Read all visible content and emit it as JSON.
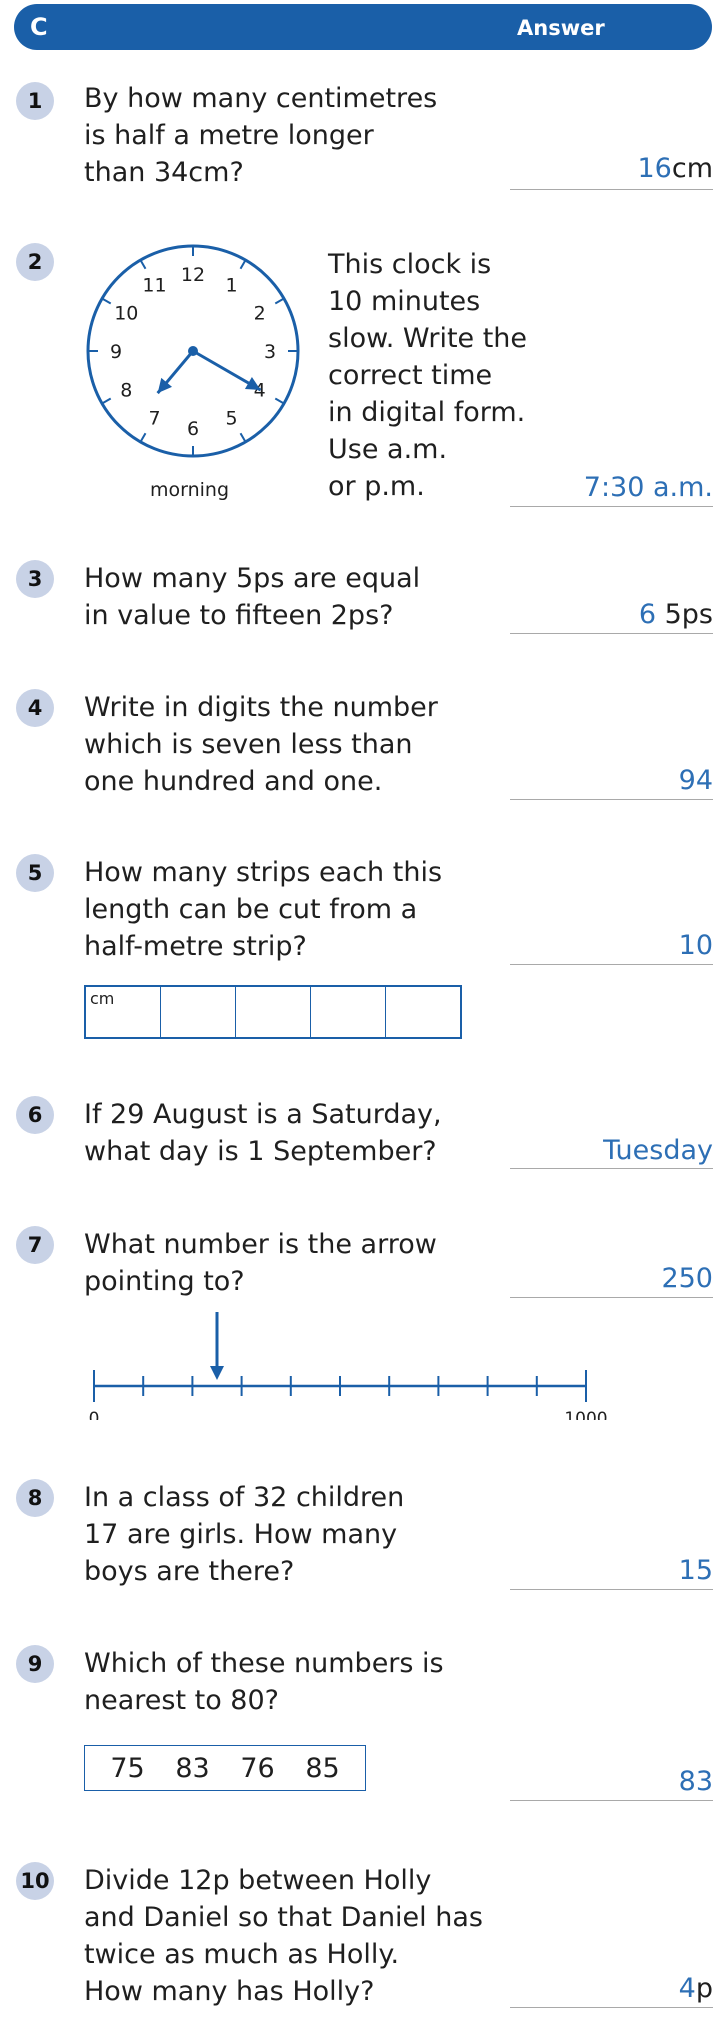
{
  "header": {
    "section": "C",
    "answer_label": "Answer"
  },
  "questions": [
    {
      "num": "1",
      "text": "By how many centimetres\nis half a metre longer\nthan 34cm?",
      "answer": "16",
      "unit": "cm"
    },
    {
      "num": "2",
      "text": "This clock is\n10 minutes\nslow. Write the\ncorrect time\nin digital form.\nUse a.m.\nor p.m.",
      "answer": "7:30 a.m.",
      "unit": "",
      "caption": "morning",
      "clock_numbers": [
        "12",
        "1",
        "2",
        "3",
        "4",
        "5",
        "6",
        "7",
        "8",
        "9",
        "10",
        "11"
      ],
      "clock_time": {
        "hour": 7,
        "minute": 20
      }
    },
    {
      "num": "3",
      "text": "How many 5ps are equal\nin value to fifteen 2ps?",
      "answer": "6",
      "unit": " 5ps"
    },
    {
      "num": "4",
      "text": "Write in digits the number\nwhich is seven less than\none hundred and one.",
      "answer": "94",
      "unit": ""
    },
    {
      "num": "5",
      "text": "How many strips each this\nlength can be cut from a\nhalf-metre strip?",
      "answer": "10",
      "unit": "",
      "strip_label": "cm",
      "strip_cells": 5
    },
    {
      "num": "6",
      "text": "If 29 August is a Saturday,\nwhat day is 1 September?",
      "answer": "Tuesday",
      "unit": ""
    },
    {
      "num": "7",
      "text": "What number is the arrow\npointing to?",
      "answer": "250",
      "unit": "",
      "numberline": {
        "start_label": "0",
        "end_label": "1000",
        "start": 0,
        "end": 1000,
        "divisions": 10,
        "arrow_value": 250
      }
    },
    {
      "num": "8",
      "text": "In a class of 32 children\n17 are girls. How many\nboys are there?",
      "answer": "15",
      "unit": ""
    },
    {
      "num": "9",
      "text": "Which of these numbers is\nnearest to 80?",
      "answer": "83",
      "unit": "",
      "options": [
        "75",
        "83",
        "76",
        "85"
      ]
    },
    {
      "num": "10",
      "text": "Divide 12p between Holly\nand Daniel so that Daniel has\ntwice as much as Holly.\nHow many has Holly?",
      "answer": "4",
      "unit": "p"
    }
  ],
  "colors": {
    "brand": "#1a5fa8",
    "answer": "#2d6fb5",
    "badge": "#c8d2e6"
  }
}
